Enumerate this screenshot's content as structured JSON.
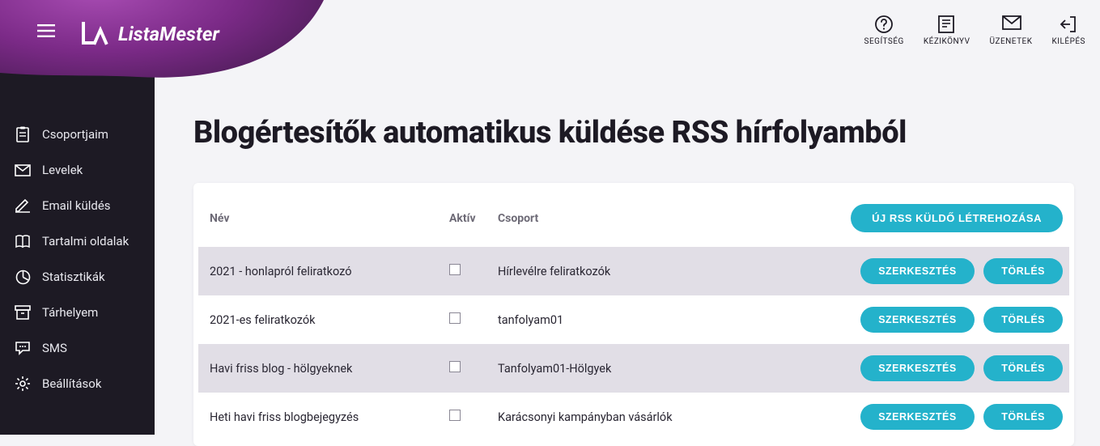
{
  "brand": {
    "name": "ListaMester"
  },
  "topnav": {
    "help": "SEGÍTSÉG",
    "manual": "KÉZIKÖNYV",
    "messages": "ÜZENETEK",
    "logout": "KILÉPÉS"
  },
  "sidebar": {
    "items": [
      {
        "label": "Csoportjaim"
      },
      {
        "label": "Levelek"
      },
      {
        "label": "Email küldés"
      },
      {
        "label": "Tartalmi oldalak"
      },
      {
        "label": "Statisztikák"
      },
      {
        "label": "Tárhelyem"
      },
      {
        "label": "SMS"
      },
      {
        "label": "Beállítások"
      }
    ]
  },
  "page": {
    "title": "Blogértesítők automatikus küldése RSS hírfolyamból"
  },
  "table": {
    "headers": {
      "name": "Név",
      "active": "Aktív",
      "group": "Csoport"
    },
    "create_button": "ÚJ RSS KÜLDŐ LÉTREHOZÁSA",
    "edit": "SZERKESZTÉS",
    "delete": "TÖRLÉS",
    "rows": [
      {
        "name": "2021 - honlapról feliratkozó",
        "active": false,
        "group": "Hírlevélre feliratkozók"
      },
      {
        "name": "2021-es feliratkozók",
        "active": false,
        "group": "tanfolyam01"
      },
      {
        "name": "Havi friss blog - hölgyeknek",
        "active": false,
        "group": "Tanfolyam01-Hölgyek"
      },
      {
        "name": "Heti havi friss blogbejegyzés",
        "active": false,
        "group": "Karácsonyi kampányban vásárlók"
      }
    ]
  }
}
